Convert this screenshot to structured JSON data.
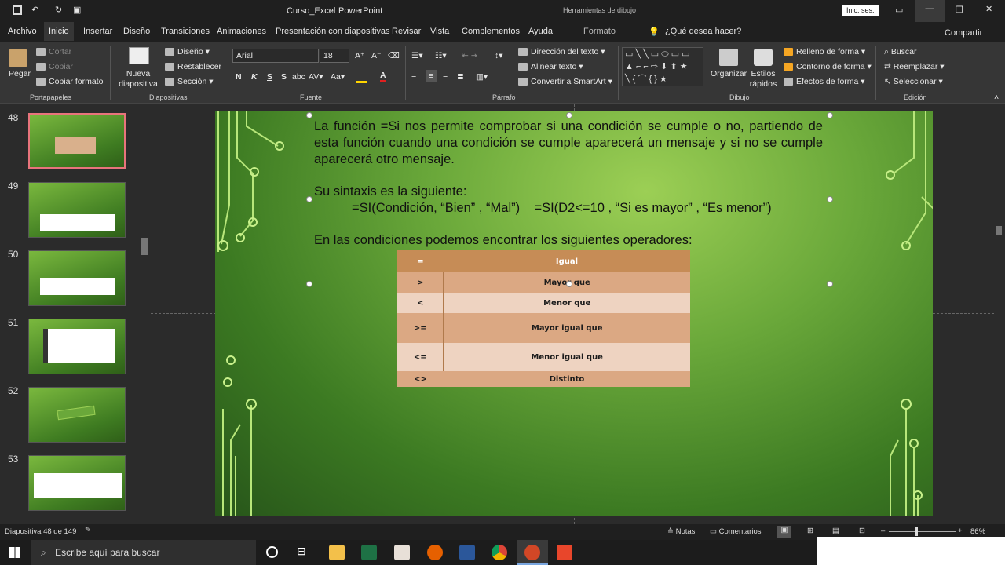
{
  "title": {
    "file": "Curso_Excel",
    "sep": "-",
    "app": "PowerPoint",
    "tools": "Herramientas de dibujo",
    "signin": "Inic. ses."
  },
  "tabs": [
    "Archivo",
    "Inicio",
    "Insertar",
    "Diseño",
    "Transiciones",
    "Animaciones",
    "Presentación con diapositivas",
    "Revisar",
    "Vista",
    "Complementos",
    "Ayuda",
    "Formato"
  ],
  "tellme": "¿Qué desea hacer?",
  "share": "Compartir",
  "ribbon": {
    "paste": "Pegar",
    "cut": "Cortar",
    "copy": "Copiar",
    "format_painter": "Copiar formato",
    "g_clip": "Portapapeles",
    "new_slide": "Nueva diapositiva",
    "layout": "Diseño",
    "reset": "Restablecer",
    "section": "Sección",
    "g_slides": "Diapositivas",
    "font_name": "Arial",
    "font_size": "18",
    "g_font": "Fuente",
    "text_dir": "Dirección del texto",
    "align_text": "Alinear texto",
    "smartart": "Convertir a SmartArt",
    "g_para": "Párrafo",
    "arrange": "Organizar",
    "quick_styles": "Estilos rápidos",
    "fill": "Relleno de forma",
    "outline": "Contorno de forma",
    "effects": "Efectos de forma",
    "g_draw": "Dibujo",
    "find": "Buscar",
    "replace": "Reemplazar",
    "select": "Seleccionar",
    "g_edit": "Edición"
  },
  "thumbnails": [
    "48",
    "49",
    "50",
    "51",
    "52",
    "53"
  ],
  "slide": {
    "p1": "La función =Si nos permite comprobar si una condición se cumple o no, partiendo de esta función cuando una condición se cumple aparecerá un mensaje y si no se cumple aparecerá otro mensaje.",
    "p2": "Su sintaxis es la siguiente:",
    "p3": "=SI(Condición, “Bien” , “Mal”)    =SI(D2<=10 , “Si es mayor” , “Es menor”)",
    "p4": "En las condiciones podemos encontrar los siguientes operadores:",
    "table": [
      [
        "=",
        "Igual"
      ],
      [
        ">",
        "Mayor que"
      ],
      [
        "<",
        "Menor que"
      ],
      [
        ">=",
        "Mayor igual que"
      ],
      [
        "<=",
        "Menor igual que"
      ],
      [
        "<>",
        "Distinto"
      ]
    ]
  },
  "status": {
    "slide": "Diapositiva 48 de 149",
    "notes": "Notas",
    "comments": "Comentarios",
    "zoom": "86%"
  },
  "taskbar": {
    "search": "Escribe aquí para buscar"
  }
}
